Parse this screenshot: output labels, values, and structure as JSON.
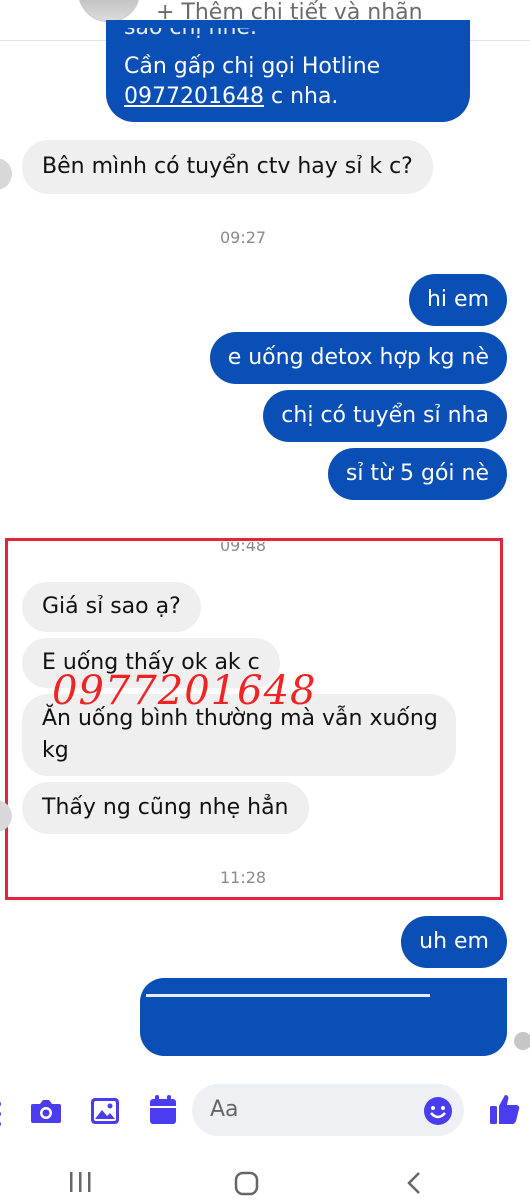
{
  "header": {
    "add_details": "+ Thêm chi tiết và nhãn"
  },
  "messages": {
    "top_out_line1": "Cần gấp chị gọi Hotline",
    "top_out_phone": "0977201648",
    "top_out_tail": " c nha.",
    "in1": "Bên mình có tuyển ctv hay sỉ k c?",
    "time1": "09:27",
    "out1": "hi em",
    "out2": "e uống detox hợp kg nè",
    "out3": "chị có tuyển sỉ nha",
    "out4": "sỉ từ 5 gói nè",
    "time2": "09:48",
    "in2": "Giá sỉ sao ạ?",
    "in3": "E uống thấy ok ak c",
    "in4_line1": "Ăn uống bình thường mà vẫn xuống",
    "in4_line2": "kg",
    "in5": "Thấy ng cũng nhẹ hẳn",
    "time3": "11:28",
    "out5": "uh em"
  },
  "watermark": "0977201648",
  "composer": {
    "placeholder": "Aa"
  },
  "colors": {
    "outgoing": "#0a4fb5",
    "incoming": "#efefef",
    "accent": "#4a3df0",
    "highlight_box": "#e0263a"
  },
  "icons": [
    "menu-dots-icon",
    "camera-icon",
    "image-icon",
    "calendar-icon",
    "emoji-icon",
    "thumbs-up-icon",
    "recent-apps-icon",
    "home-icon",
    "back-icon"
  ]
}
